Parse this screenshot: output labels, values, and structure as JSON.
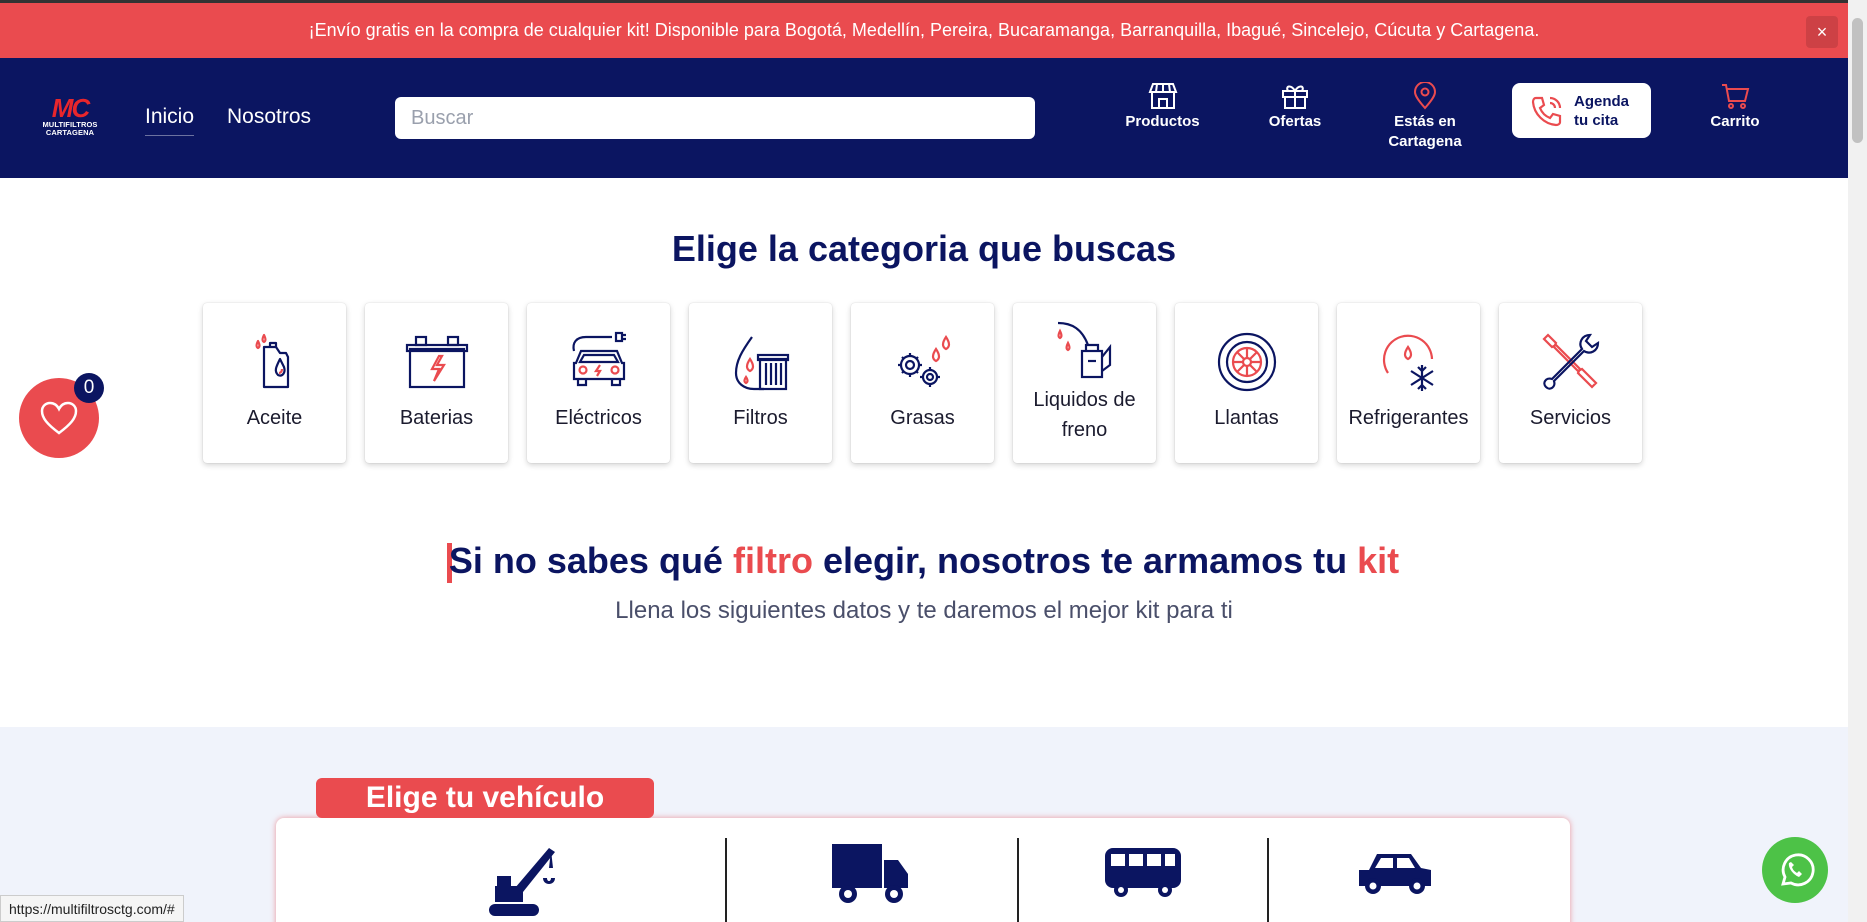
{
  "promo": {
    "text": "¡Envío gratis en la compra de cualquier kit! Disponible para Bogotá, Medellín, Pereira, Bucaramanga, Barranquilla, Ibagué, Sincelejo, Cúcuta y Cartagena.",
    "close_icon": "×"
  },
  "logo": {
    "mark": "MC",
    "line1": "MULTIFILTROS",
    "line2": "CARTAGENA"
  },
  "nav": {
    "inicio": "Inicio",
    "nosotros": "Nosotros"
  },
  "search": {
    "placeholder": "Buscar"
  },
  "header_items": {
    "productos": "Productos",
    "ofertas": "Ofertas",
    "estas_line1": "Estás en",
    "estas_line2": "Cartagena",
    "cita_line1": "Agenda",
    "cita_line2": "tu cita",
    "carrito": "Carrito"
  },
  "categories_title": "Elige la categoria que buscas",
  "categories": [
    {
      "label": "Aceite",
      "icon": "oil-bottle-icon"
    },
    {
      "label": "Baterias",
      "icon": "battery-icon"
    },
    {
      "label": "Eléctricos",
      "icon": "electric-car-icon"
    },
    {
      "label": "Filtros",
      "icon": "filter-icon"
    },
    {
      "label": "Grasas",
      "icon": "gears-icon"
    },
    {
      "label": "Liquidos de freno",
      "icon": "oil-can-icon"
    },
    {
      "label": "Llantas",
      "icon": "tire-icon"
    },
    {
      "label": "Refrigerantes",
      "icon": "coolant-icon"
    },
    {
      "label": "Servicios",
      "icon": "tools-icon"
    }
  ],
  "favorites": {
    "count": "0"
  },
  "kit": {
    "part1": "Si no sabes qué ",
    "part2": "filtro",
    "part3": " elegir, nosotros te armamos tu ",
    "part4": "kit",
    "subtitle": "Llena los siguientes datos y te daremos el mejor kit para ti"
  },
  "vehicle": {
    "tab_label": "Elige tu vehículo",
    "icons": [
      "crane-icon",
      "truck-icon",
      "bus-icon",
      "car-icon"
    ]
  },
  "status_url": "https://multifiltrosctg.com/#",
  "colors": {
    "navy": "#0b1561",
    "red": "#ea4b4f",
    "whatsapp": "#4dc247",
    "light_bg": "#f0f3fb"
  }
}
